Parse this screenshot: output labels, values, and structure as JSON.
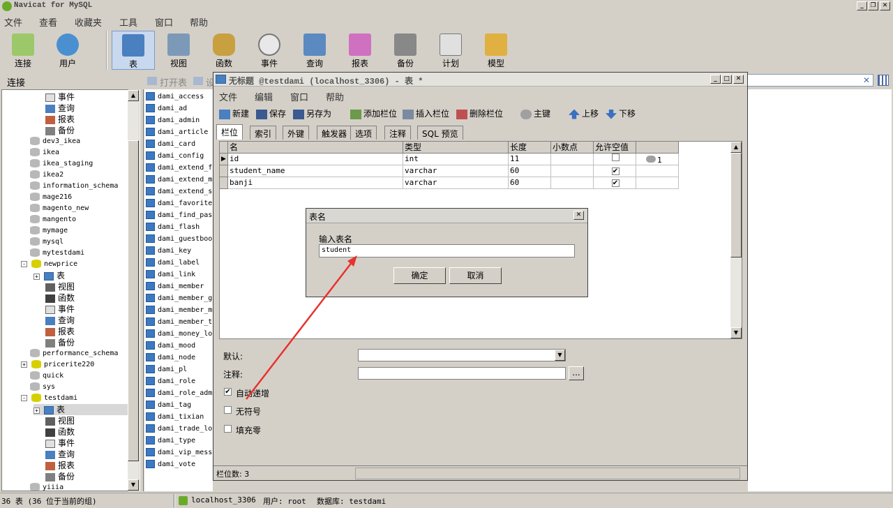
{
  "app": {
    "title": "Navicat for MySQL"
  },
  "menubar": [
    "文件",
    "查看",
    "收藏夹",
    "工具",
    "窗口",
    "帮助"
  ],
  "toolbar": [
    "连接",
    "用户",
    "表",
    "视图",
    "函数",
    "事件",
    "查询",
    "报表",
    "备份",
    "计划",
    "模型"
  ],
  "connection_label": "连接",
  "object_toolbar": {
    "open_table": "打开表",
    "design": "设"
  },
  "tree": [
    {
      "label": "事件",
      "kind": "event",
      "indent": 3
    },
    {
      "label": "查询",
      "kind": "query",
      "indent": 3
    },
    {
      "label": "报表",
      "kind": "report",
      "indent": 3
    },
    {
      "label": "备份",
      "kind": "backup",
      "indent": 3
    },
    {
      "label": "dev3_ikea",
      "kind": "db",
      "indent": 2
    },
    {
      "label": "ikea",
      "kind": "db",
      "indent": 2
    },
    {
      "label": "ikea_staging",
      "kind": "db",
      "indent": 2
    },
    {
      "label": "ikea2",
      "kind": "db",
      "indent": 2
    },
    {
      "label": "information_schema",
      "kind": "db",
      "indent": 2
    },
    {
      "label": "mage216",
      "kind": "db",
      "indent": 2
    },
    {
      "label": "magento_new",
      "kind": "db",
      "indent": 2
    },
    {
      "label": "mangento",
      "kind": "db",
      "indent": 2
    },
    {
      "label": "mymage",
      "kind": "db",
      "indent": 2
    },
    {
      "label": "mysql",
      "kind": "db",
      "indent": 2
    },
    {
      "label": "mytestdami",
      "kind": "db",
      "indent": 2
    },
    {
      "label": "newprice",
      "kind": "dbo",
      "indent": 1,
      "expander": "-"
    },
    {
      "label": "表",
      "kind": "table",
      "indent": 3,
      "expander": "+"
    },
    {
      "label": "视图",
      "kind": "view",
      "indent": 3
    },
    {
      "label": "函数",
      "kind": "func",
      "indent": 3
    },
    {
      "label": "事件",
      "kind": "event",
      "indent": 3
    },
    {
      "label": "查询",
      "kind": "query",
      "indent": 3
    },
    {
      "label": "报表",
      "kind": "report",
      "indent": 3
    },
    {
      "label": "备份",
      "kind": "backup",
      "indent": 3
    },
    {
      "label": "performance_schema",
      "kind": "db",
      "indent": 2
    },
    {
      "label": "pricerite220",
      "kind": "dbo",
      "indent": 1,
      "expander": "+"
    },
    {
      "label": "quick",
      "kind": "db",
      "indent": 2
    },
    {
      "label": "sys",
      "kind": "db",
      "indent": 2
    },
    {
      "label": "testdami",
      "kind": "dbo",
      "indent": 1,
      "expander": "-"
    },
    {
      "label": "表",
      "kind": "table",
      "indent": 3,
      "expander": "+",
      "selected": true
    },
    {
      "label": "视图",
      "kind": "view",
      "indent": 3
    },
    {
      "label": "函数",
      "kind": "func",
      "indent": 3
    },
    {
      "label": "事件",
      "kind": "event",
      "indent": 3
    },
    {
      "label": "查询",
      "kind": "query",
      "indent": 3
    },
    {
      "label": "报表",
      "kind": "report",
      "indent": 3
    },
    {
      "label": "备份",
      "kind": "backup",
      "indent": 3
    },
    {
      "label": "yiiia",
      "kind": "db",
      "indent": 2
    }
  ],
  "objects": [
    "dami_access",
    "dami_ad",
    "dami_admin",
    "dami_article",
    "dami_card",
    "dami_config",
    "dami_extend_f",
    "dami_extend_m",
    "dami_extend_s",
    "dami_favorite",
    "dami_find_pas",
    "dami_flash",
    "dami_guestboo",
    "dami_key",
    "dami_label",
    "dami_link",
    "dami_member",
    "dami_member_g",
    "dami_member_m",
    "dami_member_t",
    "dami_money_lo",
    "dami_mood",
    "dami_node",
    "dami_pl",
    "dami_role",
    "dami_role_adm",
    "dami_tag",
    "dami_tixian",
    "dami_trade_lo",
    "dami_type",
    "dami_vip_mess",
    "dami_vote"
  ],
  "window": {
    "title": "无标题 @testdami (localhost_3306) - 表 *",
    "menu": [
      "文件",
      "编辑",
      "窗口",
      "帮助"
    ],
    "toolbar": [
      "新建",
      "保存",
      "另存为",
      "添加栏位",
      "插入栏位",
      "删除栏位",
      "主键",
      "上移",
      "下移"
    ],
    "tabs": [
      "栏位",
      "索引",
      "外键",
      "触发器",
      "选项",
      "注释",
      "SQL 预览"
    ],
    "columns": [
      "名",
      "类型",
      "长度",
      "小数点",
      "允许空值",
      ""
    ],
    "rows": [
      {
        "name": "id",
        "type": "int",
        "length": "11",
        "decimals": "",
        "nullable": false,
        "key": "1"
      },
      {
        "name": "student_name",
        "type": "varchar",
        "length": "60",
        "decimals": "",
        "nullable": true,
        "key": ""
      },
      {
        "name": "banji",
        "type": "varchar",
        "length": "60",
        "decimals": "",
        "nullable": true,
        "key": ""
      }
    ],
    "props": {
      "default_label": "默认:",
      "comment_label": "注释:",
      "auto_increment": "自动递增",
      "unsigned": "无符号",
      "zerofill": "填充零",
      "auto_increment_checked": true,
      "more_button": "..."
    },
    "status": "栏位数: 3"
  },
  "dialog": {
    "title": "表名",
    "prompt": "输入表名",
    "value": "student",
    "ok": "确定",
    "cancel": "取消"
  },
  "statusbar": {
    "count": "36 表 (36 位于当前的组)",
    "connection": "localhost_3306",
    "user": "用户: root",
    "database": "数据库: testdami"
  },
  "colors": {
    "annotation_arrow": "#e8322d",
    "selected_toolbar": "#c8d8ee"
  }
}
